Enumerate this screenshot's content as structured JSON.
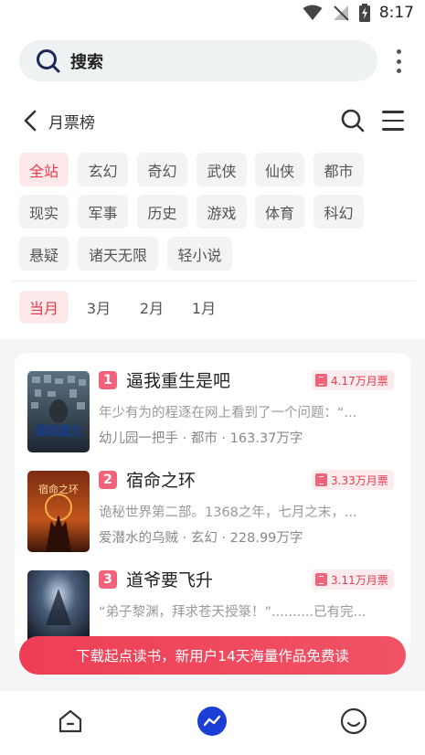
{
  "status_bar": {
    "time": "8:17",
    "icons": [
      "wifi-icon",
      "signal-off-icon",
      "battery-charging-icon"
    ]
  },
  "search": {
    "label": "搜索",
    "icon": "search-icon"
  },
  "header": {
    "title": "月票榜"
  },
  "categories": [
    "全站",
    "玄幻",
    "奇幻",
    "武侠",
    "仙侠",
    "都市",
    "现实",
    "军事",
    "历史",
    "游戏",
    "体育",
    "科幻",
    "悬疑",
    "诸天无限",
    "轻小说"
  ],
  "selected_category": "全站",
  "months": [
    "当月",
    "3月",
    "2月",
    "1月"
  ],
  "selected_month": "当月",
  "books": [
    {
      "rank": "1",
      "title": "逼我重生是吧",
      "votes": "4.17万月票",
      "desc": "年少有为的程逐在网上看到了一个问题：“...",
      "meta": "幼儿园一把手 · 都市 · 163.37万字"
    },
    {
      "rank": "2",
      "title": "宿命之环",
      "votes": "3.33万月票",
      "desc": "诡秘世界第二部。1368之年，七月之末，...",
      "meta": "爱潜水的乌贼 · 玄幻 · 228.99万字"
    },
    {
      "rank": "3",
      "title": "道爷要飞升",
      "votes": "3.11万月票",
      "desc": "“弟子黎渊，拜求苍天授箓！”..........已有完...",
      "meta": ""
    }
  ],
  "cover_text": {
    "book1": "逼我重生",
    "book2": "宿命之环"
  },
  "banner": {
    "text": "下载起点读书，新用户14天海量作品免费读"
  },
  "colors": {
    "accent": "#e8394d",
    "chip_bg": "#f3f3f3",
    "active_bg": "#fde8ea",
    "nav_active": "#1b3fd6"
  }
}
